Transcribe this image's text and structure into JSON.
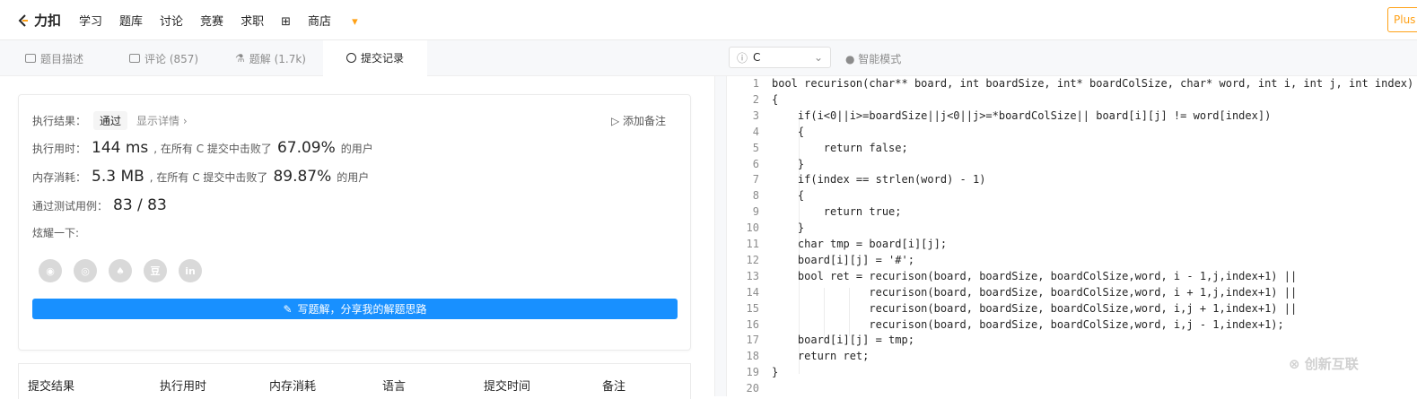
{
  "topnav": {
    "brand": "力扣",
    "items": [
      "学习",
      "题库",
      "讨论",
      "竞赛",
      "求职"
    ],
    "store": "商店",
    "plus": "Plus"
  },
  "tabs": [
    {
      "label": "题目描述"
    },
    {
      "label": "评论 (857)"
    },
    {
      "label": "题解 (1.7k)"
    },
    {
      "label": "提交记录"
    }
  ],
  "result": {
    "label_result": "执行结果：",
    "status": "通过",
    "details": "显示详情 ›",
    "add_note": "添加备注",
    "label_time": "执行用时：",
    "time": "144 ms",
    "time_mid": ", 在所有 C 提交中击败了",
    "time_pct": "67.09%",
    "time_suffix": "的用户",
    "label_mem": "内存消耗：",
    "mem": "5.3 MB",
    "mem_mid": ", 在所有 C 提交中击败了",
    "mem_pct": "89.87%",
    "mem_suffix": "的用户",
    "label_cases": "通过测试用例：",
    "cases": "83 / 83",
    "share_label": "炫耀一下:",
    "share_icons": [
      "wechat",
      "weibo",
      "qq",
      "douban",
      "linkedin"
    ],
    "write_btn": "写题解，分享我的解题思路"
  },
  "table_headers": [
    "提交结果",
    "执行用时",
    "内存消耗",
    "语言",
    "提交时间",
    "备注"
  ],
  "editor": {
    "language": "C",
    "mode": "智能模式",
    "lines": [
      "bool recurison(char** board, int boardSize, int* boardColSize, char* word, int i, int j, int index)",
      "{",
      "    if(i<0||i>=boardSize||j<0||j>=*boardColSize|| board[i][j] != word[index])",
      "    {",
      "        return false;",
      "    }",
      "    if(index == strlen(word) - 1)",
      "    {",
      "        return true;",
      "    }",
      "    char tmp = board[i][j];",
      "    board[i][j] = '#';",
      "    bool ret = recurison(board, boardSize, boardColSize,word, i - 1,j,index+1) ||",
      "               recurison(board, boardSize, boardColSize,word, i + 1,j,index+1) ||",
      "               recurison(board, boardSize, boardColSize,word, i,j + 1,index+1) ||",
      "               recurison(board, boardSize, boardColSize,word, i,j - 1,index+1);",
      "    board[i][j] = tmp;",
      "    return ret;",
      "}",
      ""
    ]
  },
  "watermark": "创新互联"
}
